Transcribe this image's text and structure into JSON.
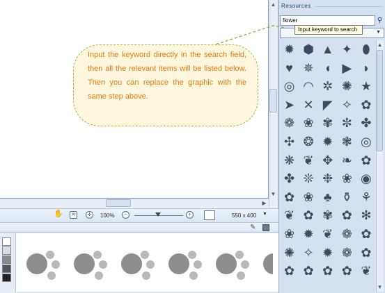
{
  "resources": {
    "title": "Resources",
    "search_value": "flower",
    "search_icon": "magnifier-icon",
    "tooltip": "Input keyword to search",
    "shape_icons": [
      "✹",
      "⬢",
      "▲",
      "✦",
      "⬮",
      "♥",
      "✵",
      "◖",
      "▶",
      "◗",
      "◎",
      "◠",
      "✲",
      "✺",
      "★",
      "➤",
      "✕",
      "◤",
      "✧",
      "✿",
      "❁",
      "❀",
      "✾",
      "✼",
      "✤",
      "✣",
      "❂",
      "✹",
      "❃",
      "◎",
      "❋",
      "❦",
      "✥",
      "❧",
      "✿",
      "✤",
      "❊",
      "❉",
      "❀",
      "◉",
      "✿",
      "❀",
      "♣",
      "⚱",
      "⚘",
      "❦",
      "✿",
      "✾",
      "✿",
      "✻",
      "❀",
      "✹",
      "❦",
      "❁",
      "✿",
      "✺",
      "✧",
      "✹",
      "❁",
      "✿",
      "✿",
      "✿",
      "✿",
      "✿",
      "❦"
    ]
  },
  "statusbar": {
    "zoom": "100%",
    "size": "550 x 400"
  },
  "callout": {
    "text": "Input the keyword directly in the search field, then all the relevant items will be listed below. Then you can replace the graphic with the same step above."
  },
  "palette_colors": [
    "#ffffff",
    "#dcdcdc",
    "#bdbdbd",
    "#8a8a8a",
    "#555555",
    "#222222"
  ]
}
